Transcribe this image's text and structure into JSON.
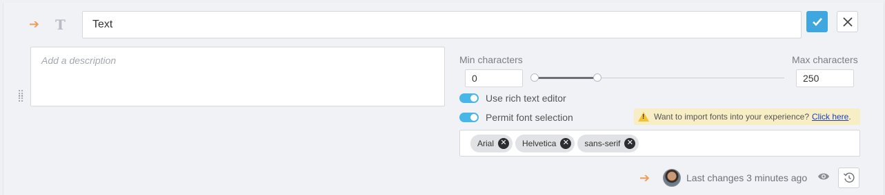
{
  "field": {
    "title_value": "Text",
    "description_placeholder": "Add a description",
    "confirm_icon": "check-icon",
    "close_icon": "close-icon",
    "type_icon": "T",
    "type_icon_name": "text-type-icon"
  },
  "characters": {
    "min_label": "Min characters",
    "max_label": "Max characters",
    "min_value": "0",
    "max_value": "250",
    "slider_range_fraction": [
      0,
      0.25
    ]
  },
  "options": {
    "rich_text_label": "Use rich text editor",
    "rich_text_enabled": true,
    "font_selection_label": "Permit font selection",
    "font_selection_enabled": true
  },
  "notice": {
    "text": "Want to import fonts into your experience?",
    "link_text": "Click here",
    "suffix": "."
  },
  "fonts": [
    "Arial",
    "Helvetica",
    "sans-serif"
  ],
  "footer": {
    "last_changes": "Last changes 3 minutes ago"
  },
  "colors": {
    "accent": "#3ea7e0",
    "arrow": "#e9a05e",
    "warning_bg": "#f8eec6"
  }
}
